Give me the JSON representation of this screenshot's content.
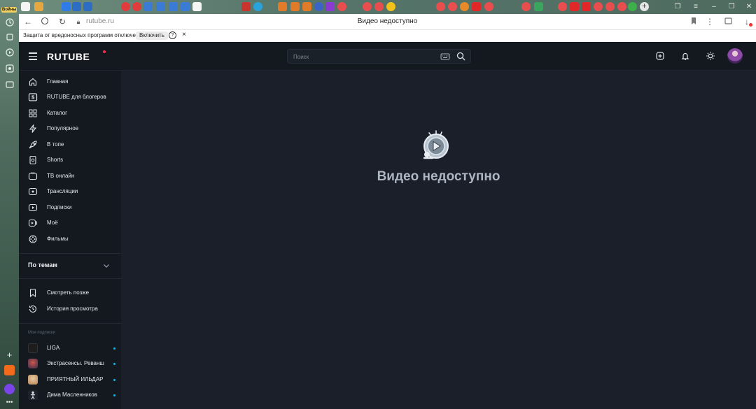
{
  "rail": {
    "badge": "Войны"
  },
  "browser": {
    "url": "rutube.ru",
    "page_title": "Видео недоступно"
  },
  "infobar": {
    "text": "Защита от вредоносных программ отключена",
    "enable_label": "Включить",
    "help_symbol": "?",
    "close_symbol": "×"
  },
  "header": {
    "logo": "RUTUBE",
    "search_placeholder": "Поиск"
  },
  "sidebar": {
    "items": [
      {
        "label": "Главная",
        "icon": "home-icon"
      },
      {
        "label": "RUTUBE для блогеров",
        "icon": "studio-icon"
      },
      {
        "label": "Каталог",
        "icon": "catalog-icon"
      },
      {
        "label": "Популярное",
        "icon": "lightning-icon"
      },
      {
        "label": "В топе",
        "icon": "rocket-icon"
      },
      {
        "label": "Shorts",
        "icon": "shorts-icon"
      },
      {
        "label": "ТВ онлайн",
        "icon": "tv-icon"
      },
      {
        "label": "Трансляции",
        "icon": "live-icon"
      },
      {
        "label": "Подписки",
        "icon": "subscriptions-icon"
      },
      {
        "label": "Моё",
        "icon": "my-videos-icon"
      },
      {
        "label": "Фильмы",
        "icon": "films-icon"
      }
    ],
    "topics_label": "По темам",
    "extra_items": [
      {
        "label": "Смотреть позже",
        "icon": "bookmark-icon"
      },
      {
        "label": "История просмотра",
        "icon": "history-icon"
      }
    ],
    "subscriptions_heading": "Мои подписки",
    "subscriptions": [
      {
        "label": "LIGA"
      },
      {
        "label": "Экстрасенсы. Реванш"
      },
      {
        "label": "ПРИЯТНЫЙ ИЛЬДАР"
      },
      {
        "label": "Дима Масленников"
      }
    ]
  },
  "main": {
    "title": "Видео недоступно"
  },
  "colors": {
    "background": "#14191f",
    "main_background": "#1a1f2a",
    "accent_dot": "#18b5e8",
    "logo_dot": "#ff2a4d"
  }
}
